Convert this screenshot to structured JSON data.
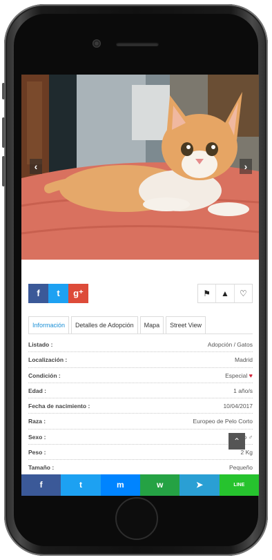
{
  "photo": {
    "alt": "Orange and white kitten lying on a red blanket"
  },
  "gallery": {
    "prev_icon": "‹",
    "next_icon": "›"
  },
  "share": {
    "facebook": "f",
    "twitter": "t",
    "googleplus": "g⁺"
  },
  "actions": {
    "flag_icon": "⚑",
    "warning_icon": "▲",
    "favorite_icon": "♡"
  },
  "tabs": [
    {
      "label": "Información"
    },
    {
      "label": "Detalles de Adopción"
    },
    {
      "label": "Mapa"
    },
    {
      "label": "Street View"
    }
  ],
  "info": [
    {
      "key": "Listado :",
      "value": "Adopción / Gatos"
    },
    {
      "key": "Localización :",
      "value": "Madrid"
    },
    {
      "key": "Condición :",
      "value": "Especial"
    },
    {
      "key": "Edad :",
      "value": "1 año/s"
    },
    {
      "key": "Fecha de nacimiento :",
      "value": "10/04/2017"
    },
    {
      "key": "Raza :",
      "value": "Europeo de Pelo Corto"
    },
    {
      "key": "Sexo :",
      "value": "Macho ♂"
    },
    {
      "key": "Peso :",
      "value": "2 Kg"
    },
    {
      "key": "Tamaño :",
      "value": "Pequeño"
    }
  ],
  "bottom_share": {
    "facebook": "f",
    "twitter": "t",
    "messenger": "m",
    "whatsapp": "w",
    "telegram": "➤",
    "line": "LINE"
  },
  "colors": {
    "facebook": "#3b5998",
    "twitter": "#1da1f2",
    "googleplus": "#dd4b39",
    "messenger": "#0084ff",
    "whatsapp": "#25a244",
    "telegram": "#2a9fd4",
    "line": "#26c32e",
    "active_tab": "#1a8fd6",
    "condition_heart": "#d2243a"
  }
}
